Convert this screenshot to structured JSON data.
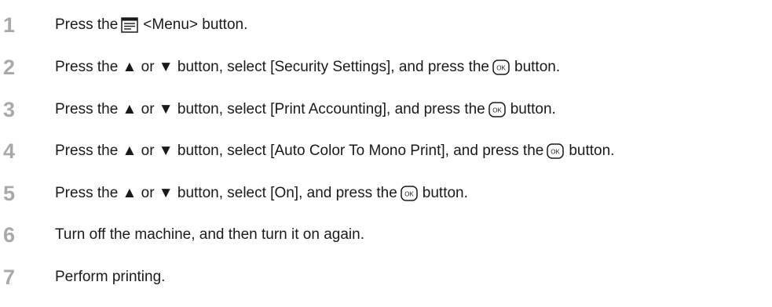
{
  "steps": [
    {
      "num": "1",
      "before": "Press the",
      "after": "<Menu> button.",
      "icon": "menu-icon"
    },
    {
      "num": "2",
      "before": "Press the ▲ or ▼ button, select [Security Settings], and press the",
      "after": "button.",
      "icon": "ok-icon"
    },
    {
      "num": "3",
      "before": "Press the ▲ or ▼ button, select [Print Accounting], and press the",
      "after": "button.",
      "icon": "ok-icon"
    },
    {
      "num": "4",
      "before": "Press the ▲ or ▼ button, select [Auto Color To Mono Print], and press the",
      "after": "button.",
      "icon": "ok-icon"
    },
    {
      "num": "5",
      "before": "Press the ▲ or ▼ button, select [On], and press the",
      "after": "button.",
      "icon": "ok-icon"
    },
    {
      "num": "6",
      "text": "Turn off the machine, and then turn it on again."
    },
    {
      "num": "7",
      "text": "Perform printing."
    }
  ],
  "ok_label": "OK",
  "colors": {
    "step_number": "#a9a9a9",
    "text": "#1a1a1a"
  }
}
